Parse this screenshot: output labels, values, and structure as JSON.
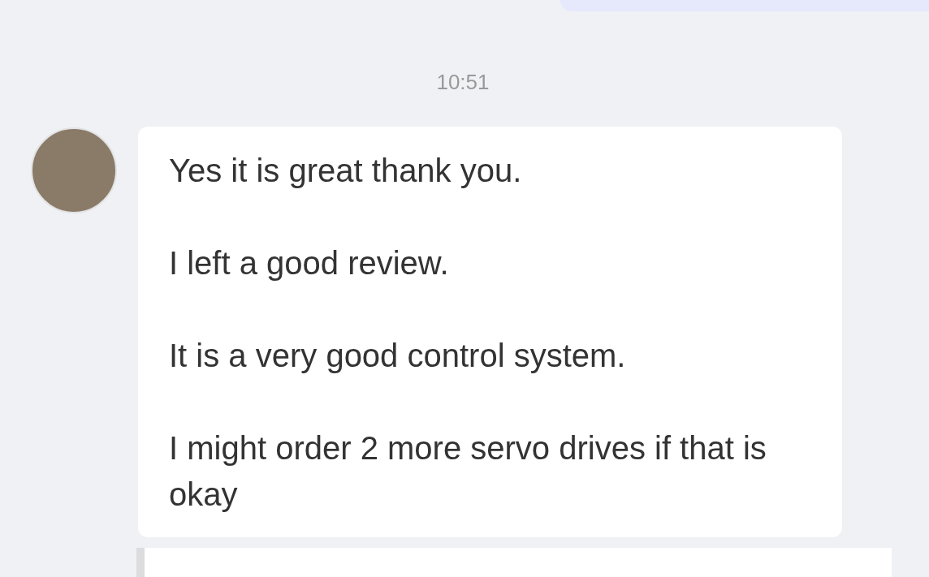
{
  "timestamp": "10:51",
  "message": {
    "paragraphs": [
      "Yes it is great thank you.",
      "I left a good review.",
      "It is a very good control system.",
      "I might order 2 more servo drives if that is okay"
    ]
  }
}
